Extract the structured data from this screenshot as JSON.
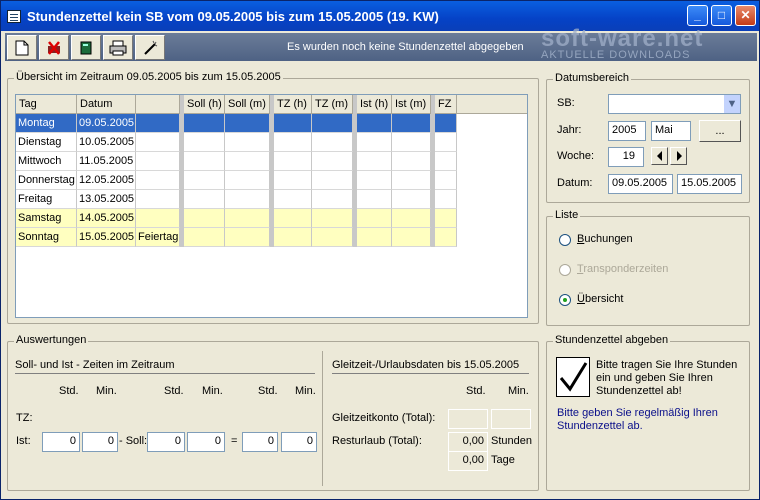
{
  "window": {
    "title": "Stundenzettel kein SB vom 09.05.2005 bis zum 15.05.2005 (19. KW)",
    "minimize": "_",
    "maximize": "□",
    "close": "✕"
  },
  "toolbar": {
    "message": "Es wurden noch keine Stundenzettel abgegeben",
    "buttons": [
      "new-icon",
      "delete-icon",
      "book-icon",
      "print-icon",
      "wand-icon"
    ]
  },
  "watermark": {
    "line1": "soft-ware.net",
    "line2": "AKTUELLE DOWNLOADS"
  },
  "overview": {
    "legend": "Übersicht im Zeitraum 09.05.2005 bis zum 15.05.2005",
    "columns": [
      "Tag",
      "Datum",
      "",
      "Soll (h)",
      "Soll (m)",
      "TZ (h)",
      "TZ (m)",
      "Ist (h)",
      "Ist (m)",
      "FZ"
    ],
    "rows": [
      {
        "tag": "Montag",
        "datum": "09.05.2005",
        "note": ""
      },
      {
        "tag": "Dienstag",
        "datum": "10.05.2005",
        "note": ""
      },
      {
        "tag": "Mittwoch",
        "datum": "11.05.2005",
        "note": ""
      },
      {
        "tag": "Donnerstag",
        "datum": "12.05.2005",
        "note": ""
      },
      {
        "tag": "Freitag",
        "datum": "13.05.2005",
        "note": ""
      },
      {
        "tag": "Samstag",
        "datum": "14.05.2005",
        "note": ""
      },
      {
        "tag": "Sonntag",
        "datum": "15.05.2005",
        "note": "Feiertag"
      }
    ],
    "selected_row": 0,
    "colors": {
      "selected": "#316ac5",
      "weekend": "#ffffc0"
    }
  },
  "datumsbereich": {
    "legend": "Datumsbereich",
    "sb_label": "SB:",
    "sb_value": "",
    "jahr_label": "Jahr:",
    "jahr": "2005",
    "monat": "Mai",
    "dots": "...",
    "woche_label": "Woche:",
    "woche": "19",
    "datum_label": "Datum:",
    "von": "09.05.2005",
    "bis": "15.05.2005"
  },
  "liste": {
    "legend": "Liste",
    "options": [
      {
        "label": "Buchungen",
        "access": "B",
        "rest": "uchungen",
        "checked": false,
        "enabled": true
      },
      {
        "label": "Transponderzeiten",
        "access": "T",
        "rest": "ransponderzeiten",
        "checked": false,
        "enabled": false
      },
      {
        "label": "Übersicht",
        "access": "Ü",
        "rest": "bersicht",
        "checked": true,
        "enabled": true
      }
    ]
  },
  "auswertungen": {
    "legend": "Auswertungen",
    "left_title": "Soll- und Ist - Zeiten im Zeitraum",
    "std": "Std.",
    "min": "Min.",
    "tz_label": "TZ:",
    "ist_label": "Ist:",
    "soll_label": "- Soll:",
    "eq": "=",
    "ist_std": "0",
    "ist_min": "0",
    "soll_std": "0",
    "soll_min": "0",
    "diff_std": "0",
    "diff_min": "0",
    "right_title": "Gleitzeit-/Urlaubsdaten bis 15.05.2005",
    "gleit_label": "Gleitzeitkonto (Total):",
    "gleit_std": "",
    "gleit_min": "",
    "urlaub_label": "Resturlaub (Total):",
    "urlaub_stunden": "0,00",
    "stunden_unit": "Stunden",
    "urlaub_tage": "0,00",
    "tage_unit": "Tage"
  },
  "abgeben": {
    "legend": "Stundenzettel abgeben",
    "text": "Bitte tragen Sie Ihre Stunden ein und geben Sie Ihren Stundenzettel ab!",
    "help": "Bitte geben Sie regelmäßig Ihren Stundenzettel ab."
  }
}
